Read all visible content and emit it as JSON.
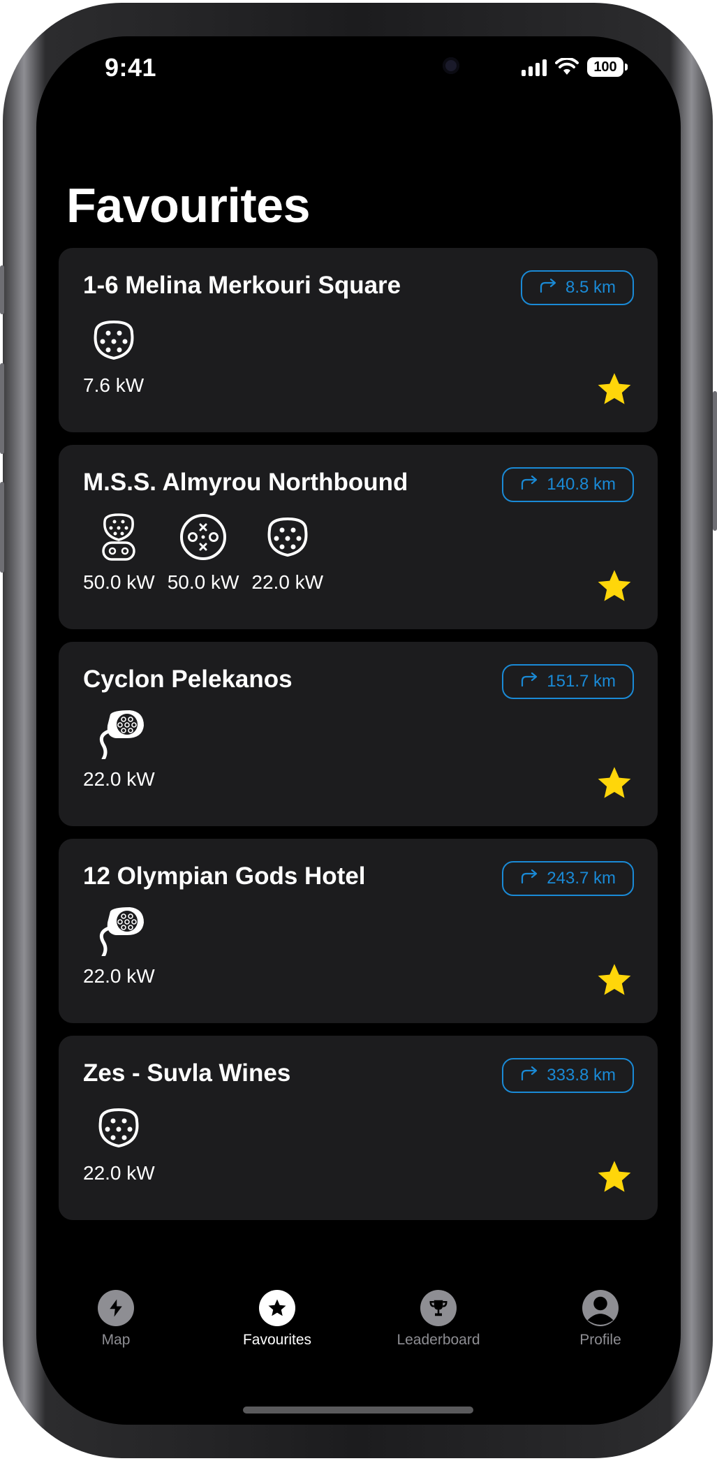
{
  "status_bar": {
    "time": "9:41",
    "battery": "100"
  },
  "page_title": "Favourites",
  "theme": {
    "accent": "#1a8ad6",
    "star": "#ffd60a",
    "card_bg": "#1c1c1e",
    "active_tab": "#ffffff",
    "inactive_tab": "#8e8e93"
  },
  "stations": [
    {
      "name": "1-6 Melina Merkouri Square",
      "distance": "8.5 km",
      "favourite": true,
      "connectors": [
        {
          "icon": "type2-socket-icon",
          "power": "7.6 kW"
        }
      ]
    },
    {
      "name": "M.S.S. Almyrou Northbound",
      "distance": "140.8 km",
      "favourite": true,
      "connectors": [
        {
          "icon": "ccs2-icon",
          "power": "50.0 kW"
        },
        {
          "icon": "chademo-icon",
          "power": "50.0 kW"
        },
        {
          "icon": "type2-socket-icon",
          "power": "22.0 kW"
        }
      ]
    },
    {
      "name": "Cyclon Pelekanos",
      "distance": "151.7 km",
      "favourite": true,
      "connectors": [
        {
          "icon": "type2-cable-icon",
          "power": "22.0 kW"
        }
      ]
    },
    {
      "name": "12 Olympian Gods Hotel",
      "distance": "243.7 km",
      "favourite": true,
      "connectors": [
        {
          "icon": "type2-cable-icon",
          "power": "22.0 kW"
        }
      ]
    },
    {
      "name": "Zes - Suvla Wines",
      "distance": "333.8 km",
      "favourite": true,
      "connectors": [
        {
          "icon": "type2-socket-icon",
          "power": "22.0 kW"
        }
      ]
    }
  ],
  "tabs": [
    {
      "label": "Map",
      "icon": "lightning-icon",
      "active": false
    },
    {
      "label": "Favourites",
      "icon": "star-icon",
      "active": true
    },
    {
      "label": "Leaderboard",
      "icon": "trophy-icon",
      "active": false
    },
    {
      "label": "Profile",
      "icon": "person-icon",
      "active": false
    }
  ]
}
